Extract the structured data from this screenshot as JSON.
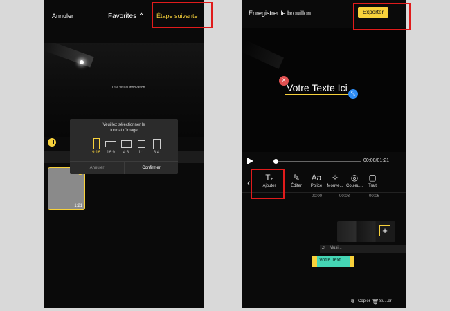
{
  "left_screen": {
    "cancel": "Annuler",
    "favorites": "Favorites",
    "next_step": "Étape suivante",
    "video_caption": "True visual innovation",
    "clip_duration": "1:21",
    "dialog": {
      "title_line1": "Veuillez sélectionner le",
      "title_line2": "format d'image",
      "formats": [
        "9:16",
        "16:9",
        "4:3",
        "1:1",
        "3:4"
      ],
      "cancel": "Annuler",
      "confirm": "Confirmer"
    }
  },
  "right_screen": {
    "save_draft": "Enregistrer le brouillon",
    "export": "Exporter",
    "overlay_text": "Votre Texte Ici",
    "time": "00:00/01:21",
    "tools": [
      "Ajouter",
      "Éditer",
      "Police",
      "Mouve...",
      "Couleu...",
      "Trait"
    ],
    "ruler": [
      "00:00",
      "00:03",
      "00:06"
    ],
    "music_label": "Musi...",
    "text_clip": "Votre Text...",
    "copy": "Copier",
    "delete": "Su...er"
  },
  "colors": {
    "accent": "#f7d13b",
    "highlight": "#e01b1b",
    "text_clip": "#45d6b5",
    "handle_blue": "#2f8df5",
    "delete_red": "#e05050"
  }
}
